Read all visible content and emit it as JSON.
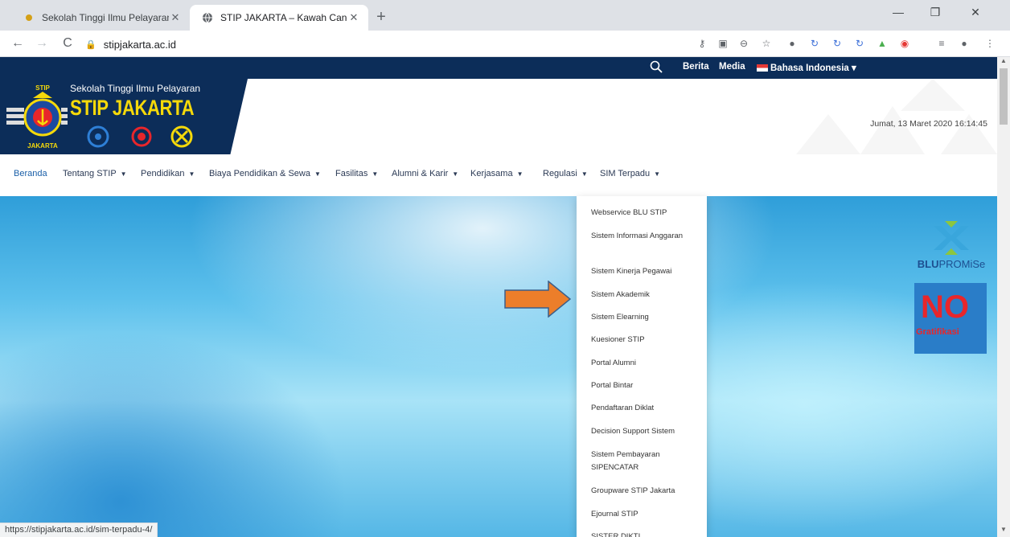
{
  "browser": {
    "tabs": [
      {
        "title": "Sekolah Tinggi Ilmu Pelayaran Ja",
        "close": "✕"
      },
      {
        "title": "STIP JAKARTA – Kawah Candradi",
        "close": "✕"
      }
    ],
    "new_tab": "+",
    "window_controls": {
      "minimize": "—",
      "restore": "❐",
      "close": "✕"
    },
    "url": "stipjakarta.ac.id",
    "status_url": "https://stipjakarta.ac.id/sim-terpadu-4/"
  },
  "topbar": {
    "links": [
      "Berita",
      "Media"
    ],
    "language": "Bahasa Indonesia"
  },
  "header": {
    "subtitle": "Sekolah Tinggi Ilmu Pelayaran",
    "name": "STIP JAKARTA",
    "logo_top": "STIP",
    "logo_bottom": "JAKARTA",
    "datetime": "Jumat, 13 Maret 2020 16:14:45"
  },
  "menu": [
    {
      "label": "Beranda",
      "has_caret": false,
      "active": true
    },
    {
      "label": "Tentang STIP",
      "has_caret": true
    },
    {
      "label": "Pendidikan",
      "has_caret": true
    },
    {
      "label": "Biaya Pendidikan & Sewa",
      "has_caret": true
    },
    {
      "label": "Fasilitas",
      "has_caret": true
    },
    {
      "label": "Alumni & Karir",
      "has_caret": true
    },
    {
      "label": "Kerjasama",
      "has_caret": true
    },
    {
      "label": "Regulasi",
      "has_caret": true
    },
    {
      "label": "SIM Terpadu",
      "has_caret": true
    }
  ],
  "dropdown": [
    "Webservice BLU STIP",
    "Sistem Informasi Anggaran",
    "Sistem Kinerja Pegawai",
    "Sistem Akademik",
    "Sistem Elearning",
    "Kuesioner STIP",
    "Portal Alumni",
    "Portal Bintar",
    "Pendaftaran Diklat",
    "Decision Support Sistem",
    "Sistem Pembayaran SIPENCATAR",
    "Groupware STIP Jakarta",
    "Ejournal STIP",
    "SISTER DIKTI"
  ],
  "sidebar": {
    "blu_bold": "BLU",
    "blu_light": "PROMiSe",
    "nograt_no": "NO",
    "nograt_text": "Gratifikasi"
  },
  "colors": {
    "navy": "#0c2d59",
    "gold": "#f5d90a",
    "arrow": "#ec7e2a"
  }
}
